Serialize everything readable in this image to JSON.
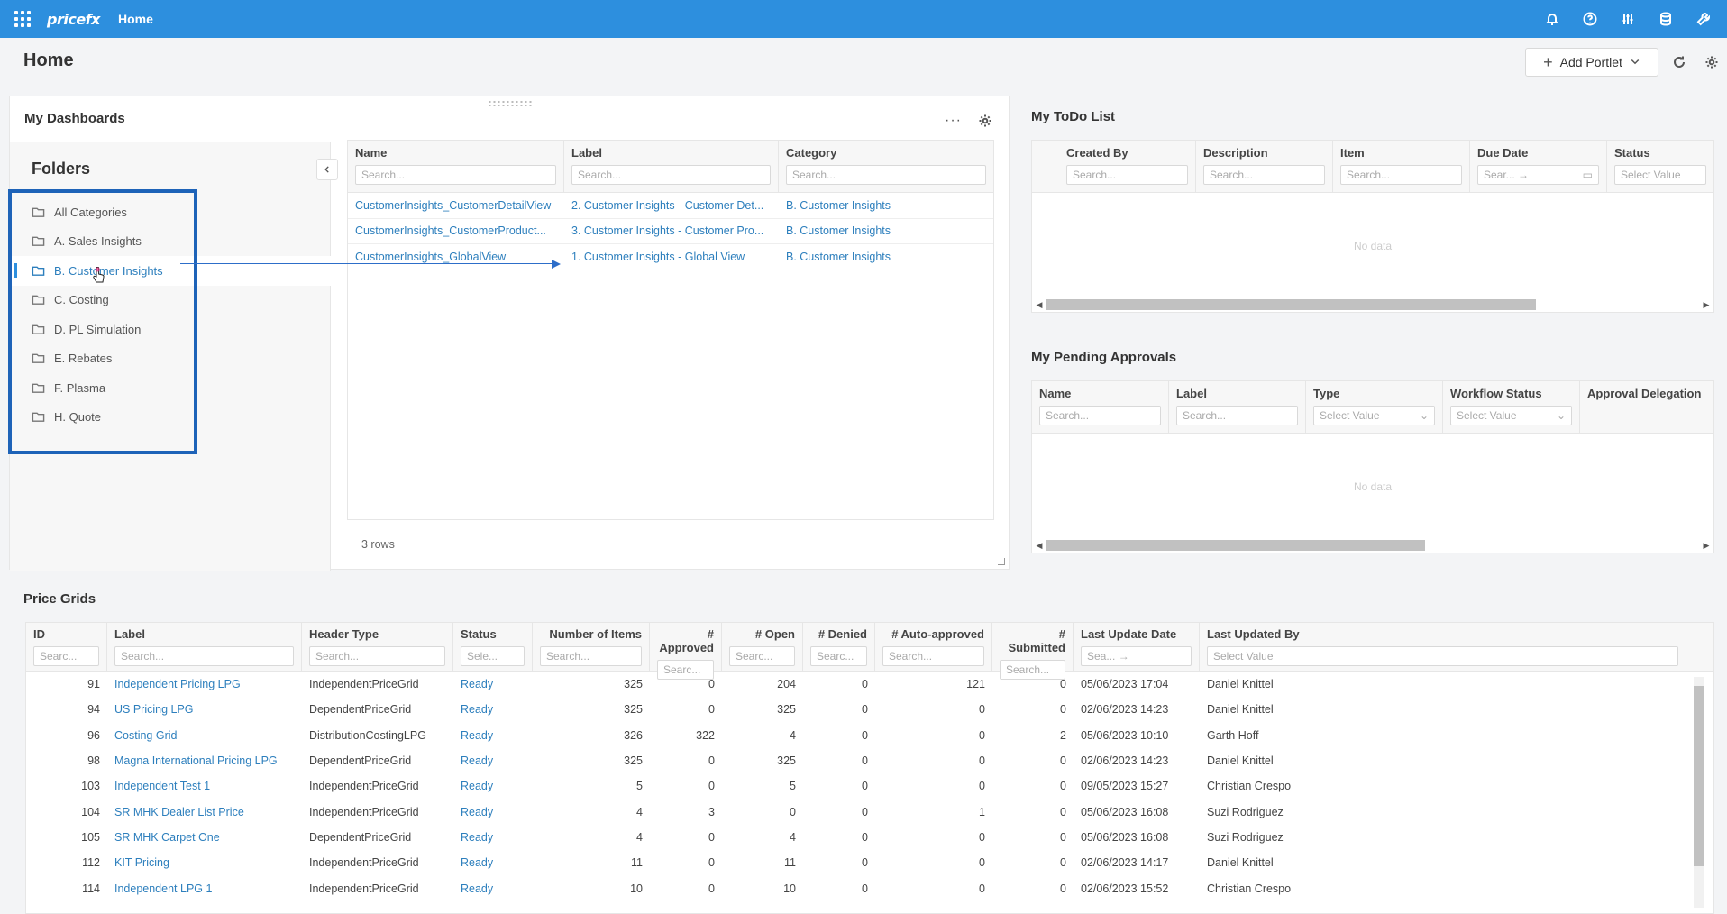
{
  "topbar": {
    "logo": "pricefx",
    "nav_home": "Home"
  },
  "page": {
    "title": "Home",
    "add_portlet": "Add Portlet"
  },
  "dashboards": {
    "title": "My Dashboards",
    "folders_title": "Folders",
    "folders": [
      {
        "label": "All Categories"
      },
      {
        "label": "A. Sales Insights"
      },
      {
        "label": "B. Customer Insights",
        "active": true
      },
      {
        "label": "C. Costing"
      },
      {
        "label": "D. PL Simulation"
      },
      {
        "label": "E. Rebates"
      },
      {
        "label": "F. Plasma"
      },
      {
        "label": "H. Quote"
      }
    ],
    "columns": [
      "Name",
      "Label",
      "Category"
    ],
    "search_placeholder": "Search...",
    "rows": [
      {
        "name": "CustomerInsights_CustomerDetailView",
        "label": "2. Customer Insights - Customer Det...",
        "category": "B. Customer Insights"
      },
      {
        "name": "CustomerInsights_CustomerProduct...",
        "label": "3. Customer Insights - Customer Pro...",
        "category": "B. Customer Insights"
      },
      {
        "name": "CustomerInsights_GlobalView",
        "label": "1. Customer Insights - Global View",
        "category": "B. Customer Insights"
      }
    ],
    "row_count": "3 rows"
  },
  "todo": {
    "title": "My ToDo List",
    "columns": [
      "Created By",
      "Description",
      "Item",
      "Due Date",
      "Status"
    ],
    "search_placeholder": "Search...",
    "date_placeholder": "Sear... →",
    "status_placeholder": "Select Value",
    "no_data": "No data"
  },
  "approvals": {
    "title": "My Pending Approvals",
    "columns": [
      "Name",
      "Label",
      "Type",
      "Workflow Status",
      "Approval Delegation"
    ],
    "search_placeholder": "Search...",
    "select_placeholder": "Select Value",
    "no_data": "No data"
  },
  "price_grids": {
    "title": "Price Grids",
    "columns": [
      "ID",
      "Label",
      "Header Type",
      "Status",
      "Number of Items",
      "# Approved",
      "# Open",
      "# Denied",
      "# Auto-approved",
      "# Submitted",
      "Last Update Date",
      "Last Updated By"
    ],
    "filters": [
      "Searc...",
      "Search...",
      "Search...",
      "Sele...",
      "Search...",
      "Searc...",
      "Searc...",
      "Searc...",
      "Search...",
      "Search...",
      "Sea... →",
      "Select Value"
    ],
    "rows": [
      [
        "91",
        "Independent Pricing LPG",
        "IndependentPriceGrid",
        "Ready",
        "325",
        "0",
        "204",
        "0",
        "121",
        "0",
        "05/06/2023 17:04",
        "Daniel Knittel"
      ],
      [
        "94",
        "US Pricing LPG",
        "DependentPriceGrid",
        "Ready",
        "325",
        "0",
        "325",
        "0",
        "0",
        "0",
        "02/06/2023 14:23",
        "Daniel Knittel"
      ],
      [
        "96",
        "Costing Grid",
        "DistributionCostingLPG",
        "Ready",
        "326",
        "322",
        "4",
        "0",
        "0",
        "2",
        "05/06/2023 10:10",
        "Garth Hoff"
      ],
      [
        "98",
        "Magna International Pricing LPG",
        "DependentPriceGrid",
        "Ready",
        "325",
        "0",
        "325",
        "0",
        "0",
        "0",
        "02/06/2023 14:23",
        "Daniel Knittel"
      ],
      [
        "103",
        "Independent Test 1",
        "IndependentPriceGrid",
        "Ready",
        "5",
        "0",
        "5",
        "0",
        "0",
        "0",
        "09/05/2023 15:27",
        "Christian Crespo"
      ],
      [
        "104",
        "SR MHK Dealer List Price",
        "IndependentPriceGrid",
        "Ready",
        "4",
        "3",
        "0",
        "0",
        "1",
        "0",
        "05/06/2023 16:08",
        "Suzi Rodriguez"
      ],
      [
        "105",
        "SR MHK Carpet One",
        "DependentPriceGrid",
        "Ready",
        "4",
        "0",
        "4",
        "0",
        "0",
        "0",
        "05/06/2023 16:08",
        "Suzi Rodriguez"
      ],
      [
        "112",
        "KIT Pricing",
        "IndependentPriceGrid",
        "Ready",
        "11",
        "0",
        "11",
        "0",
        "0",
        "0",
        "02/06/2023 14:17",
        "Daniel Knittel"
      ],
      [
        "114",
        "Independent LPG 1",
        "IndependentPriceGrid",
        "Ready",
        "10",
        "0",
        "10",
        "0",
        "0",
        "0",
        "02/06/2023 15:52",
        "Christian Crespo"
      ]
    ]
  },
  "colors": {
    "brand": "#2d8fde",
    "link": "#2d7fbd",
    "highlight": "#1e63b8"
  }
}
